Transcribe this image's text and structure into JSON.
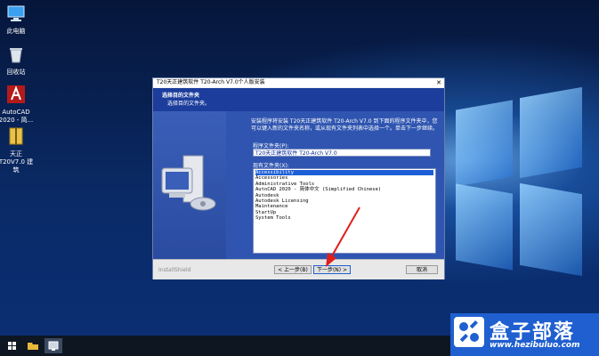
{
  "desktop": {
    "icons": [
      {
        "label": "此电脑"
      },
      {
        "label": "回收站"
      },
      {
        "label": "AutoCAD 2020 - 简..."
      },
      {
        "label": "天正 T20V7.0 建筑"
      }
    ]
  },
  "dialog": {
    "title": "T20天正建筑软件 T20-Arch V7.0个人版安装",
    "close": "✕",
    "header": {
      "title": "选择目的文件夹",
      "subtitle": "选择目的文件夹。"
    },
    "description": "安装程序将安装 T20天正建筑软件 T20-Arch V7.0 到下面的程序文件夹中，您可以键入新的文件夹名称，或从现有文件夹列表中选择一个。单击下一步继续。",
    "folder_label": "程序文件夹(P):",
    "folder_value": "T20天正建筑软件 T20-Arch V7.0",
    "existing_label": "现有文件夹(X):",
    "existing_folders": [
      "Accessibility",
      "Accessories",
      "Administrative Tools",
      "AutoCAD 2020 - 简体中文 (Simplified Chinese)",
      "Autodesk",
      "Autodesk Licensing",
      "Maintenance",
      "StartUp",
      "System Tools"
    ],
    "footer": {
      "brand": "InstallShield",
      "back": "< 上一步(B)",
      "next": "下一步(N) >",
      "cancel": "取消"
    }
  },
  "watermark": {
    "title": "盒子部落",
    "url": "www.hezibuluo.com"
  },
  "colors": {
    "header_band": "#1c3d9c",
    "main_area": "#2f55b0",
    "arrow": "#e0201c",
    "watermark": "#1f5fd0"
  }
}
